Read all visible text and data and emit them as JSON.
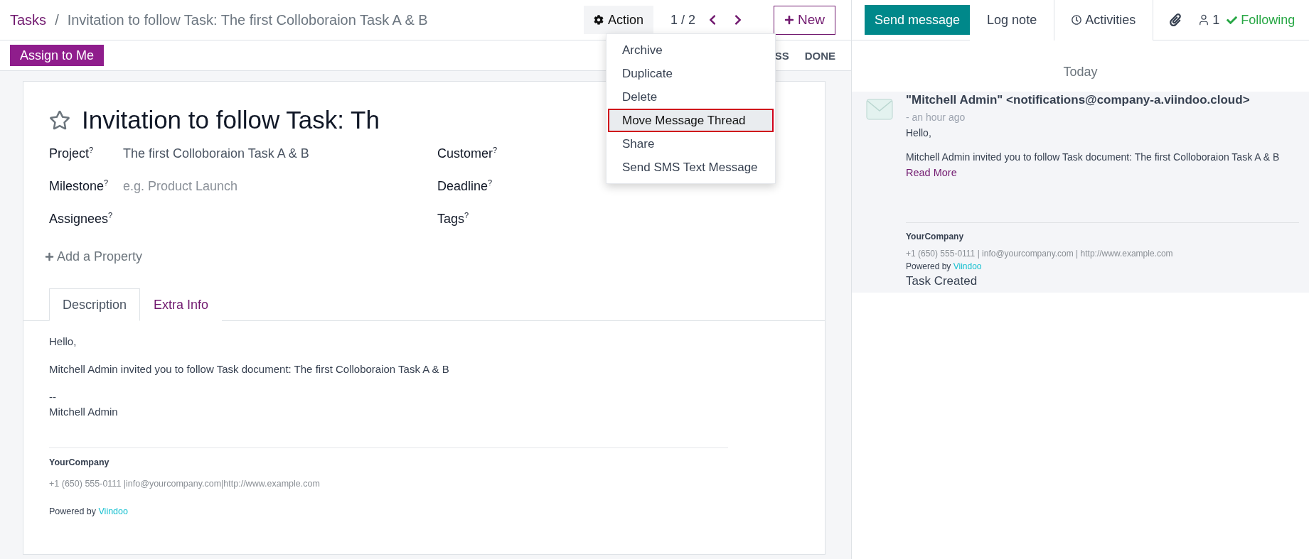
{
  "breadcrumb": {
    "parent": "Tasks",
    "separator": "/",
    "current": "Invitation to follow Task: The first Colloboraion Task A & B"
  },
  "control_panel": {
    "action": "Action",
    "pager": "1 / 2",
    "new": "New"
  },
  "action_menu": [
    {
      "label": "Archive",
      "selected": false
    },
    {
      "label": "Duplicate",
      "selected": false
    },
    {
      "label": "Delete",
      "selected": false
    },
    {
      "label": "Move Message Thread",
      "selected": true
    },
    {
      "label": "Share",
      "selected": false
    },
    {
      "label": "Send SMS Text Message",
      "selected": false
    }
  ],
  "status_bar": {
    "button": "Assign to Me",
    "stages": [
      "SS",
      "DONE"
    ]
  },
  "form": {
    "starred": false,
    "title": "Invitation to follow Task: Th",
    "left_fields": [
      {
        "label": "Project$^{?}$",
        "value": "The first Colloboraion Task A & B"
      },
      {
        "label": "Milestone$^{?}$",
        "placeholder": "e.g. Product Launch"
      },
      {
        "label": "Assignees$^{?}$"
      }
    ],
    "right_fields": [
      {
        "label": "Customer$^{?}$"
      },
      {
        "label": "Deadline$^{?}$"
      },
      {
        "label": "Tags$^{?}$"
      }
    ],
    "add_property": "Add a Property",
    "tabs": [
      {
        "label": "Description",
        "selected": true
      },
      {
        "label": "Extra Info",
        "selected": false
      }
    ],
    "description": {
      "greeting": "Hello,",
      "body": "Mitchell Admin invited you to follow Task document: The first Colloboraion Task A & B",
      "dashes": "--",
      "signature": "Mitchell Admin",
      "company": "YourCompany",
      "contact": "+1 (650) 555-0111 |info@yourcompany.com|http://www.example.com",
      "powered": "Powered by",
      "powered_link": "Viindoo"
    }
  },
  "chatter": {
    "send_message": "Send message",
    "log_note": "Log note",
    "activities": "Activities",
    "followers": "1",
    "following": "Following",
    "date": "Today",
    "message": {
      "author": "\"Mitchell Admin\" <notifications@company-a.viindoo.cloud>",
      "time": "- an hour ago",
      "greeting": "Hello,",
      "body": "Mitchell Admin invited you to follow Task document: The first Colloboraion Task A & B",
      "read_more": "Read More",
      "company": "YourCompany",
      "contact": "+1 (650) 555-0111 | info@yourcompany.com | http://www.example.com",
      "powered": "Powered by",
      "powered_link": "Viindoo",
      "event": "Task Created"
    }
  }
}
